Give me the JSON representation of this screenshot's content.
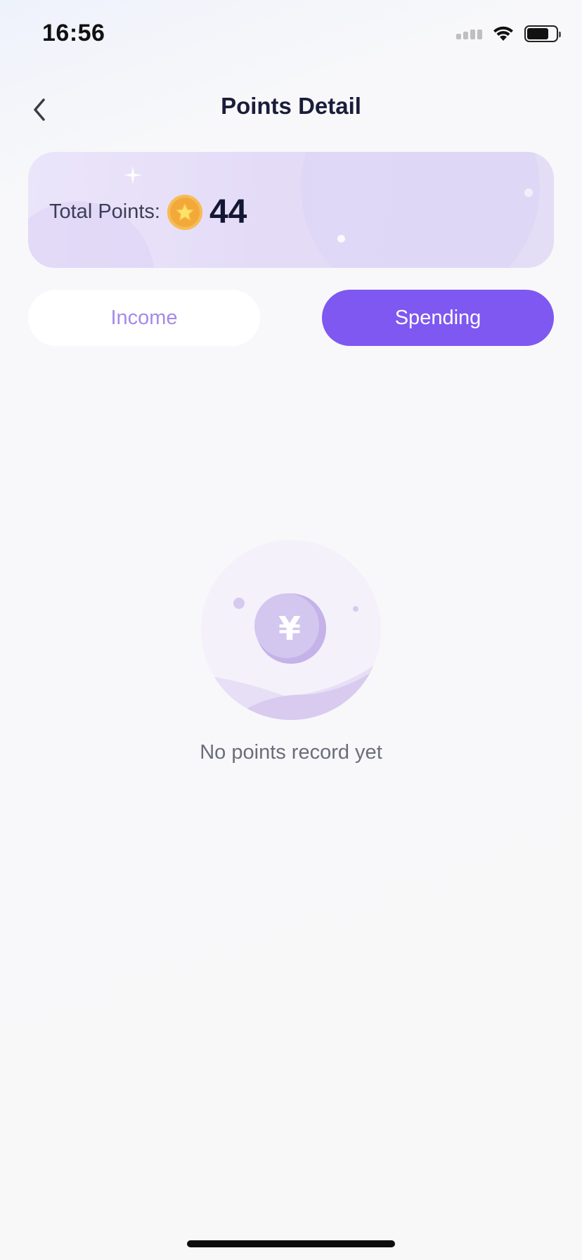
{
  "status_bar": {
    "time": "16:56",
    "icons": [
      "cellular-signal-icon",
      "wifi-icon",
      "battery-icon"
    ]
  },
  "header": {
    "title": "Points Detail",
    "back_icon": "chevron-left-icon"
  },
  "points_card": {
    "label": "Total Points:",
    "value": "44",
    "icon": "star-coin-icon"
  },
  "tabs": [
    {
      "label": "Income",
      "selected": false
    },
    {
      "label": "Spending",
      "selected": true
    }
  ],
  "empty_state": {
    "icon": "yen-coin-icon",
    "message": "No points record yet"
  },
  "colors": {
    "accent": "#7e58f0",
    "tab_inactive_text": "#a58ae9",
    "coin": "#f3a93a",
    "title": "#1a1d3a"
  }
}
